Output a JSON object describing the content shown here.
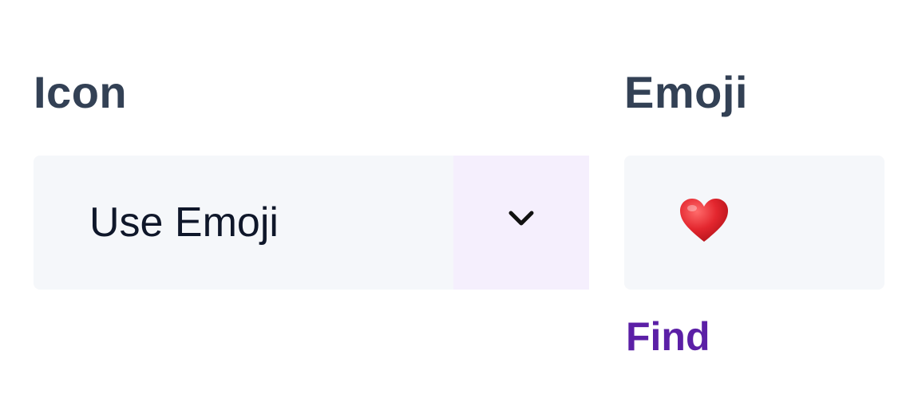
{
  "icon_field": {
    "label": "Icon",
    "selected_value": "Use Emoji",
    "toggle_icon": "chevron-down-icon"
  },
  "emoji_field": {
    "label": "Emoji",
    "value": "❤️",
    "value_icon": "red-heart-icon",
    "find_link": "Find"
  },
  "colors": {
    "label_text": "#334155",
    "field_background": "#f5f7fa",
    "toggle_background": "#f5effd",
    "link": "#5b1fa6",
    "heart": "#e3262e"
  }
}
